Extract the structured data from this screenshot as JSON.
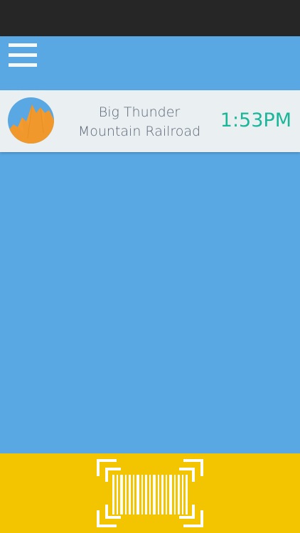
{
  "menu": {
    "icon": "hamburger-menu-icon"
  },
  "ride": {
    "name_line1": "Big Thunder",
    "name_line2": "Mountain Railroad",
    "time": "1:53PM",
    "icon": "mountain-icon"
  },
  "scan": {
    "icon": "barcode-scan-icon"
  },
  "colors": {
    "background": "#5aa8e3",
    "status_bar": "#262626",
    "card": "#eaeff1",
    "time_text": "#1bb69a",
    "ride_text": "#5b6577",
    "scan_bar": "#f3c400"
  }
}
